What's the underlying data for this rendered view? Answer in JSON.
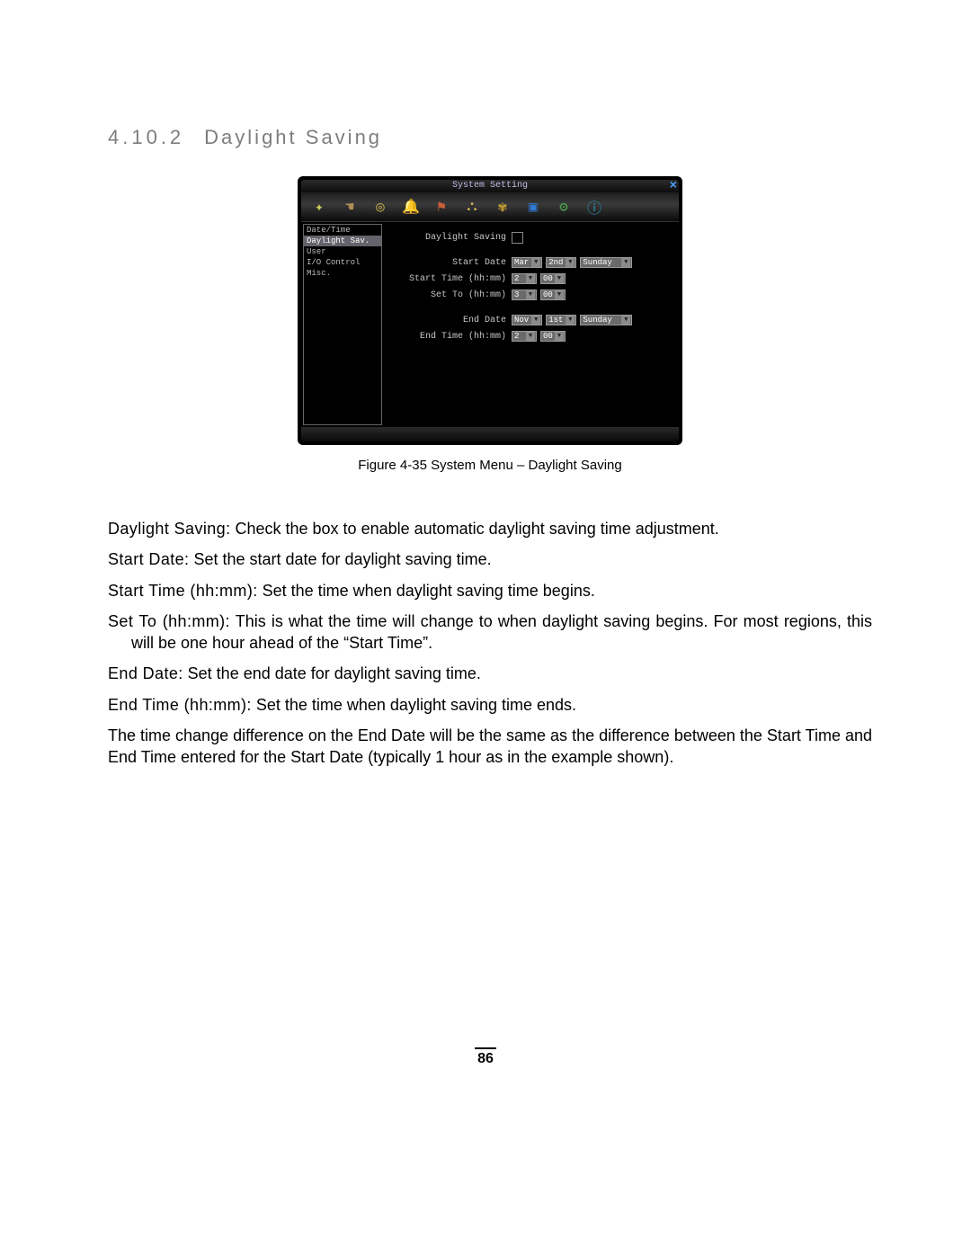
{
  "heading": {
    "number": "4.10.2",
    "title": "Daylight Saving"
  },
  "screenshot": {
    "window_title": "System Setting",
    "toolbar_icons": [
      "sparkle-icon",
      "hand-icon",
      "reel-icon",
      "bell-icon",
      "flag-icon",
      "network-icon",
      "bee-icon",
      "monitor-icon",
      "gear-icon",
      "info-icon"
    ],
    "sidebar": [
      "Date/Time",
      "Daylight Sav.",
      "User",
      "I/O Control",
      "Misc."
    ],
    "sidebar_selected": 1,
    "labels": {
      "dst": "Daylight Saving",
      "start_date": "Start Date",
      "start_time": "Start Time (hh:mm)",
      "set_to": "Set To (hh:mm)",
      "end_date": "End Date",
      "end_time": "End Time (hh:mm)"
    },
    "values": {
      "start_month": "Mar",
      "start_week": "2nd",
      "start_day": "Sunday",
      "start_hh": "2",
      "start_mm": "00",
      "setto_hh": "3",
      "setto_mm": "00",
      "end_month": "Nov",
      "end_week": "1st",
      "end_day": "Sunday",
      "end_hh": "2",
      "end_mm": "00"
    }
  },
  "caption": "Figure 4-35   System Menu – Daylight Saving",
  "desc": {
    "p1_term": "Daylight Saving:",
    "p1_body": " Check the box to enable automatic daylight saving time adjustment.",
    "p2_term": "Start Date:",
    "p2_body": " Set the start date for daylight saving time.",
    "p3_term": "Start Time (hh:mm):",
    "p3_body": " Set the time when daylight saving time begins.",
    "p4_term": "Set To (hh:mm):",
    "p4_body": " This is what the time will change to when daylight saving begins. For most regions, this will be one hour ahead of the “Start Time”.",
    "p5_term": "End Date:",
    "p5_body": " Set the end date for daylight saving time.",
    "p6_term": "End Time (hh:mm):",
    "p6_body": " Set the time when daylight saving time ends.",
    "p7": "The time change difference on the End Date will be the same as the difference between the Start Time and End Time entered for the Start Date (typically 1 hour as in the example shown)."
  },
  "page_number": "86"
}
